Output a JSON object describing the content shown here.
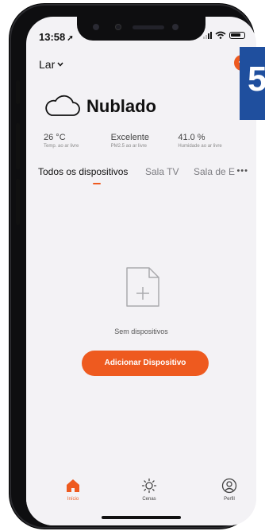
{
  "status_bar": {
    "time": "13:58",
    "location_glyph": "➚"
  },
  "header": {
    "home_name": "Lar",
    "add_symbol": "+"
  },
  "weather": {
    "title": "Nublado",
    "stats": [
      {
        "value": "26 °C",
        "label": "Temp. ao ar livre"
      },
      {
        "value": "Excelente",
        "label": "PM2.5 ao ar livre"
      },
      {
        "value": "41.0 %",
        "label": "Humidade ao ar livre"
      }
    ]
  },
  "tabs": {
    "items": [
      "Todos os dispositivos",
      "Sala TV",
      "Sala de E"
    ],
    "more": "•••",
    "active_index": 0
  },
  "empty": {
    "message": "Sem dispositivos",
    "button": "Adicionar Dispositivo",
    "icon": "file-add-icon"
  },
  "nav": {
    "items": [
      {
        "label": "Início",
        "icon": "home-icon"
      },
      {
        "label": "Cenas",
        "icon": "sun-icon"
      },
      {
        "label": "Perfil",
        "icon": "profile-icon"
      }
    ],
    "active_index": 0
  },
  "brand_badge": {
    "text": "5"
  },
  "colors": {
    "accent": "#ee5a1f",
    "screen_bg": "#f3f2f5",
    "frame": "#0e0e10",
    "badge": "#1f4f9e"
  }
}
